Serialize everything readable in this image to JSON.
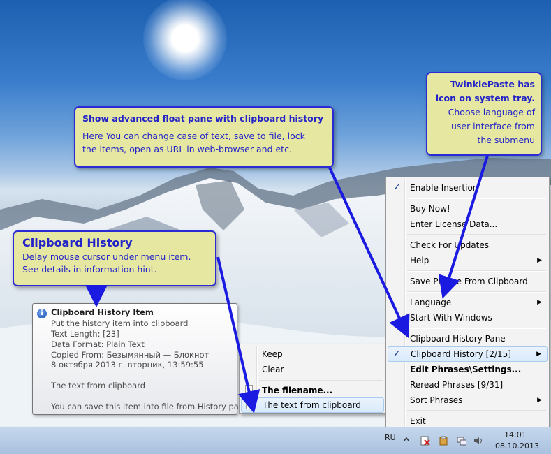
{
  "callouts": {
    "float_pane": {
      "title": "Show advanced float pane with clipboard history",
      "body_line1": "Here You can change case of text, save to file, lock",
      "body_line2": "the items, open as URL in web-browser and etc."
    },
    "history": {
      "title": "Clipboard History",
      "body_line1": "Delay mouse cursor under menu item.",
      "body_line2": "See details in information hint."
    },
    "tray": {
      "line1": "TwinkiePaste has",
      "line2": "icon on system tray.",
      "line3": "Choose language of",
      "line4": "user interface from",
      "line5": "the submenu"
    }
  },
  "tray_menu": {
    "items": [
      {
        "label": "Enable Insertion",
        "checked": true
      },
      {
        "label": "Buy Now!"
      },
      {
        "label": "Enter License Data..."
      },
      {
        "label": "Check For Updates"
      },
      {
        "label": "Help",
        "submenu": true
      },
      {
        "label": "Save Phrase From Clipboard"
      },
      {
        "label": "Language",
        "submenu": true
      },
      {
        "label": "Start With Windows"
      },
      {
        "label": "Clipboard History Pane"
      },
      {
        "label": "Clipboard History [2/15]",
        "checked": true,
        "submenu": true,
        "highlighted": true
      },
      {
        "label": "Edit Phrases\\Settings...",
        "bold": true
      },
      {
        "label": "Reread Phrases [9/31]"
      },
      {
        "label": "Sort Phrases",
        "submenu": true
      },
      {
        "label": "Exit"
      }
    ]
  },
  "history_submenu": {
    "items": [
      {
        "label": "Keep"
      },
      {
        "label": "Clear"
      },
      {
        "label": "The filename...",
        "bold": true
      },
      {
        "label": "The text from clipboard",
        "highlighted": true
      }
    ]
  },
  "hint": {
    "title": "Clipboard History Item",
    "line1": "Put the history item into clipboard",
    "line2": "Text Length: [23]",
    "line3": "Data Format: Plain Text",
    "line4": "Copied From: Безымянный — Блокнот",
    "line5": "8 октября 2013 г. вторник, 13:59:55",
    "line6": "The text from clipboard",
    "line7": "You can save this item into file from History pane"
  },
  "taskbar": {
    "language": "RU",
    "time": "14:01",
    "date": "08.10.2013"
  },
  "colors": {
    "callout_bg": "#e6e8a2",
    "callout_border": "#2b2bd6",
    "callout_text": "#2323c8",
    "arrow": "#1a1ae0"
  }
}
